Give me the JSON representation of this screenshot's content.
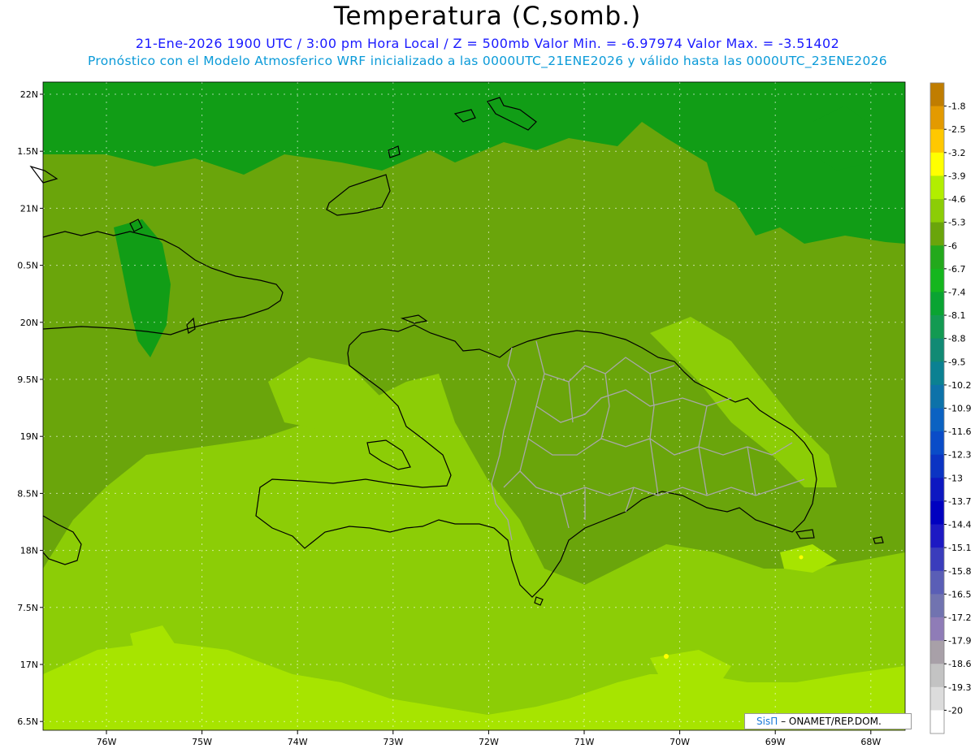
{
  "header": {
    "title": "Temperatura (C,somb.)",
    "subtitle1": "21-Ene-2026  1900 UTC / 3:00 pm Hora Local / Z = 500mb  Valor Min. = -6.97974  Valor Max. = -3.51402",
    "subtitle2": "Pronóstico con el Modelo Atmosferico WRF inicializado a las 0000UTC_21ENE2026 y válido hasta las  0000UTC_23ENE2026"
  },
  "map": {
    "lat_labels": [
      "22N",
      "1.5N",
      "21N",
      "0.5N",
      "20N",
      "9.5N",
      "19N",
      "8.5N",
      "18N",
      "7.5N",
      "17N",
      "6.5N"
    ],
    "lon_labels": [
      "76W",
      "75W",
      "74W",
      "73W",
      "72W",
      "71W",
      "70W",
      "69W",
      "68W"
    ],
    "lat_range": [
      16.5,
      22.1
    ],
    "lon_range": [
      -76.6,
      -67.6
    ],
    "grid": true,
    "field_colors": {
      "dark_green": "#119d16",
      "mid_green": "#6aa50b",
      "light_green": "#8ccd06",
      "yellow_green": "#a7e400"
    }
  },
  "colorbar": {
    "labels": [
      "-1.8",
      "-2.5",
      "-3.2",
      "-3.9",
      "-4.6",
      "-5.3",
      "-6",
      "-6.7",
      "-7.4",
      "-8.1",
      "-8.8",
      "-9.5",
      "-10.2",
      "-10.9",
      "-11.6",
      "-12.3",
      "-13",
      "-13.7",
      "-14.4",
      "-15.1",
      "-15.8",
      "-16.5",
      "-17.2",
      "-17.9",
      "-18.6",
      "-19.3",
      "-20"
    ],
    "colors": [
      "#c07d00",
      "#e39a00",
      "#ffc800",
      "#ffff00",
      "#b2ee00",
      "#8ccd06",
      "#6aa50b",
      "#23a91c",
      "#15b61e",
      "#0aa432",
      "#139a52",
      "#118a74",
      "#0b8192",
      "#0d72a9",
      "#0b62c2",
      "#0a4cc8",
      "#0b34c3",
      "#0d18c1",
      "#0000c0",
      "#1d19c3",
      "#3a3cbc",
      "#5a5eb6",
      "#7173b0",
      "#8f7cb7",
      "#a8a0a8",
      "#c3c3c3",
      "#dcdcdc",
      "#ffffff"
    ]
  },
  "credit": {
    "logo": "SisΠ",
    "text": "– ONAMET/REP.DOM."
  }
}
